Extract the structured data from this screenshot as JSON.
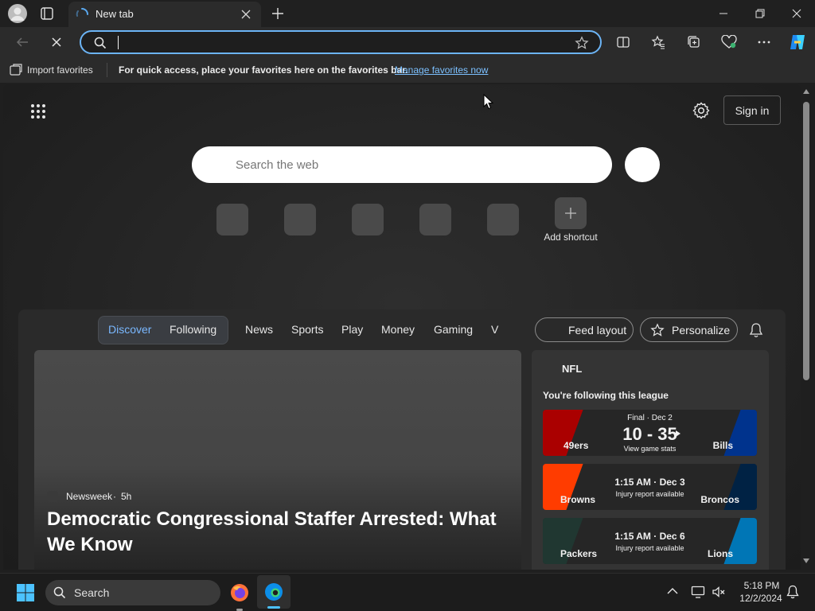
{
  "browser": {
    "tab_title": "New tab",
    "address_value": "",
    "favorites_bar": {
      "import_label": "Import favorites",
      "message": "For quick access, place your favorites here on the favorites bar.",
      "manage_link": "Manage favorites now"
    }
  },
  "newtab": {
    "sign_in": "Sign in",
    "search_placeholder": "Search the web",
    "add_shortcut": "Add shortcut",
    "feed_tabs": [
      "Discover",
      "Following",
      "News",
      "Sports",
      "Play",
      "Money",
      "Gaming",
      "V"
    ],
    "feed_layout": "Feed layout",
    "personalize": "Personalize"
  },
  "article": {
    "source": "Newsweek",
    "age": "5h",
    "headline": "Democratic Congressional Staffer Arrested: What We Know"
  },
  "nfl_card": {
    "title": "NFL",
    "subtitle": "You're following this league",
    "games": [
      {
        "status": "Final · Dec 2",
        "score": "10 - 35",
        "detail": "View game stats",
        "team_left": "49ers",
        "team_right": "Bills",
        "color_left": "#aa0000",
        "color_right": "#00338d"
      },
      {
        "time": "1:15 AM · Dec 3",
        "detail": "Injury report available",
        "team_left": "Browns",
        "team_right": "Broncos",
        "color_left": "#ff3c00",
        "color_right": "#002244"
      },
      {
        "time": "1:15 AM · Dec 6",
        "detail": "Injury report available",
        "team_left": "Packers",
        "team_right": "Lions",
        "color_left": "#203731",
        "color_right": "#0076b6"
      }
    ]
  },
  "taskbar": {
    "search_label": "Search",
    "time": "5:18 PM",
    "date": "12/2/2024"
  }
}
